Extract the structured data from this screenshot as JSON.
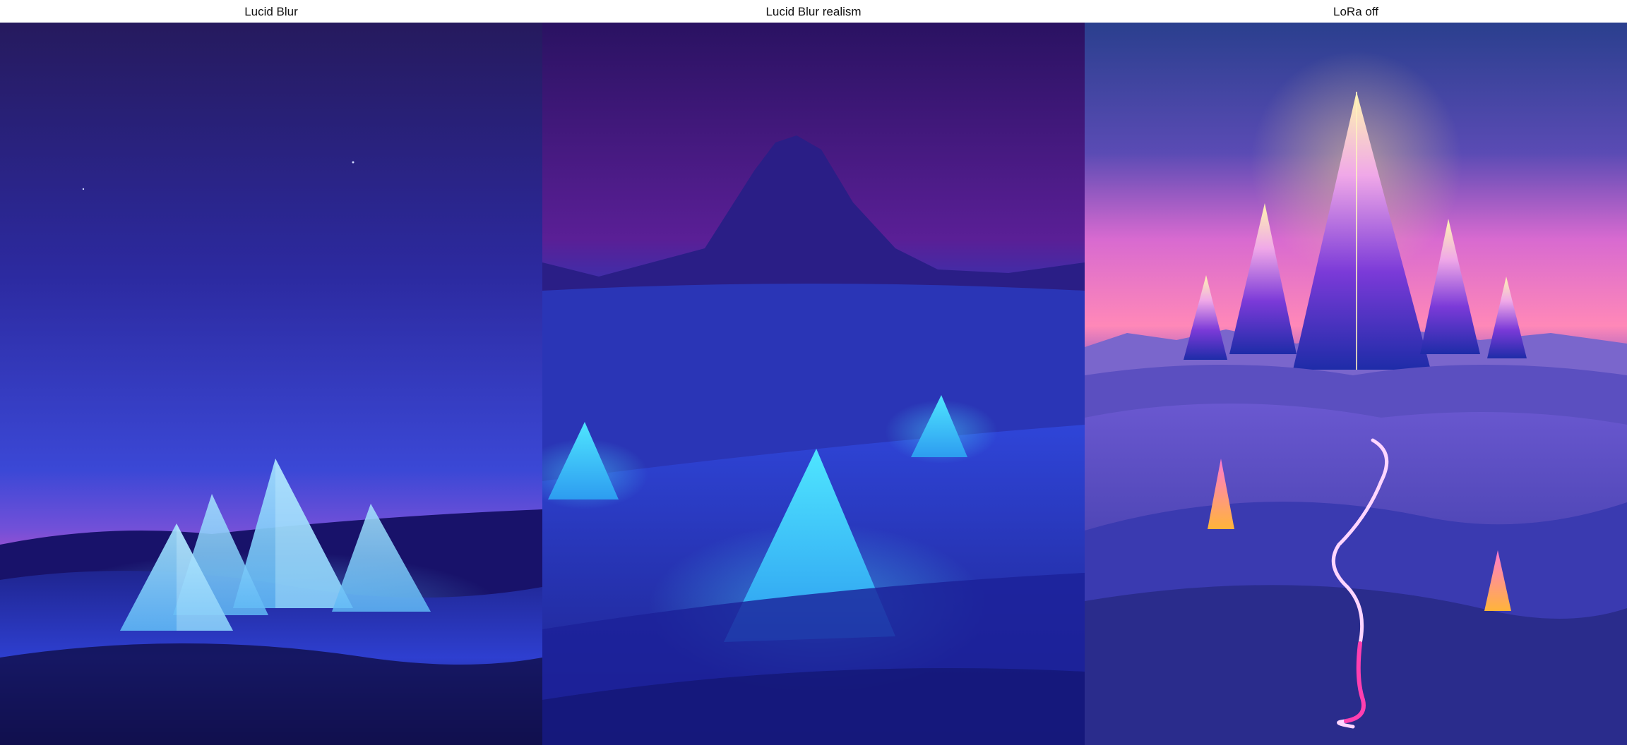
{
  "panels": [
    {
      "label": "Lucid Blur",
      "description": "Glowing translucent pyramids in blue night dunes"
    },
    {
      "label": "Lucid Blur realism",
      "description": "Glowing cyan pyramids in blue dunes with mountain silhouette"
    },
    {
      "label": "LoRa off",
      "description": "Neon crystal spires in purple desert with glowing path"
    }
  ],
  "colors": {
    "background": "#ffffff",
    "label_text": "#111111"
  }
}
